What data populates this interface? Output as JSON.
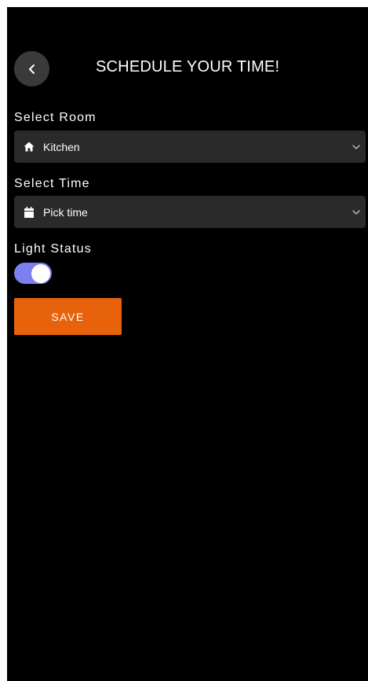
{
  "header": {
    "title": "SCHEDULE YOUR TIME!",
    "back_icon": "chevron-left-icon"
  },
  "room": {
    "label": "Select Room",
    "value": "Kitchen",
    "icon": "home-icon",
    "dropdown_icon": "chevron-down-icon"
  },
  "time": {
    "label": "Select Time",
    "value": "Pick time",
    "icon": "calendar-icon",
    "dropdown_icon": "chevron-down-icon"
  },
  "light": {
    "label": "Light Status",
    "enabled": true
  },
  "actions": {
    "save_label": "SAVE"
  },
  "colors": {
    "background": "#000000",
    "field_bg": "#2a2a2a",
    "toggle_on": "#7b7ff0",
    "save_button": "#e8620c"
  }
}
